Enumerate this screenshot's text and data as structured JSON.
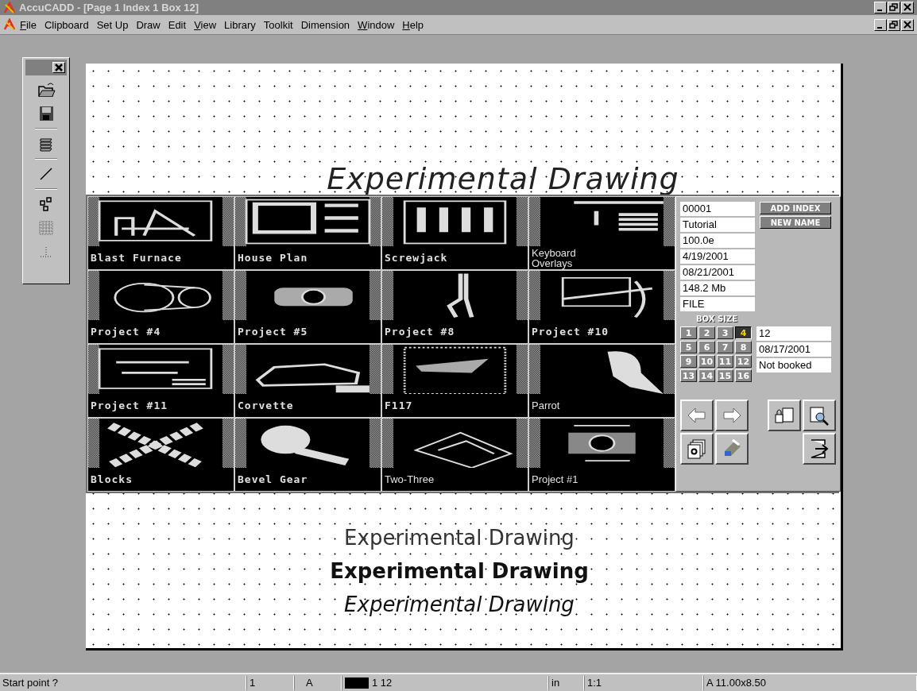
{
  "window": {
    "title": "AccuCADD - [Page 1 Index 1 Box 12]"
  },
  "menu": [
    {
      "label": "File",
      "underline_first": true
    },
    {
      "label": "Clipboard",
      "underline_first": false
    },
    {
      "label": "Set Up",
      "underline_first": false
    },
    {
      "label": "Draw",
      "underline_first": false
    },
    {
      "label": "Edit",
      "underline_first": false
    },
    {
      "label": "View",
      "underline_first": true
    },
    {
      "label": "Library",
      "underline_first": false
    },
    {
      "label": "Toolkit",
      "underline_first": false
    },
    {
      "label": "Dimension",
      "underline_first": false
    },
    {
      "label": "Window",
      "underline_first": true
    },
    {
      "label": "Help",
      "underline_first": true
    }
  ],
  "drawing": {
    "title": "Experimental Drawing",
    "samples": [
      {
        "text": "Experimental Drawing",
        "kind": "light"
      },
      {
        "text": "Experimental Drawing",
        "kind": "bold"
      },
      {
        "text": "Experimental Drawing",
        "kind": "italic"
      }
    ]
  },
  "library": {
    "tiles": [
      {
        "label": "Blast Furnace",
        "kind": "bitmap"
      },
      {
        "label": "House Plan",
        "kind": "bitmap"
      },
      {
        "label": "Screwjack",
        "kind": "bitmap"
      },
      {
        "label": "Keyboard Overlays",
        "kind": "vector"
      },
      {
        "label": "Project #4",
        "kind": "bitmap"
      },
      {
        "label": "Project #5",
        "kind": "bitmap"
      },
      {
        "label": "Project #8",
        "kind": "bitmap"
      },
      {
        "label": "Project #10",
        "kind": "bitmap"
      },
      {
        "label": "Project #11",
        "kind": "bitmap"
      },
      {
        "label": "Corvette",
        "kind": "bitmap"
      },
      {
        "label": "F117",
        "kind": "bitmap"
      },
      {
        "label": "Parrot",
        "kind": "vector"
      },
      {
        "label": "Blocks",
        "kind": "bitmap"
      },
      {
        "label": "Bevel Gear",
        "kind": "bitmap"
      },
      {
        "label": "Two-Three",
        "kind": "vector"
      },
      {
        "label": "Project #1",
        "kind": "vector"
      }
    ],
    "info": [
      "00001",
      "Tutorial",
      "100.0e",
      "4/19/2001",
      "08/21/2001",
      "148.2 Mb",
      "FILE"
    ],
    "buttons": [
      "ADD INDEX",
      "NEW NAME"
    ],
    "box_size_label": "BOX SIZE",
    "box_sizes": [
      {
        "label": "1",
        "selected": false
      },
      {
        "label": "2",
        "selected": false
      },
      {
        "label": "3",
        "selected": false
      },
      {
        "label": "4",
        "selected": true
      },
      {
        "label": "5",
        "selected": false
      },
      {
        "label": "6",
        "selected": false
      },
      {
        "label": "7",
        "selected": false
      },
      {
        "label": "8",
        "selected": false
      },
      {
        "label": "9",
        "selected": false
      },
      {
        "label": "10",
        "selected": false
      },
      {
        "label": "11",
        "selected": false
      },
      {
        "label": "12",
        "selected": false
      },
      {
        "label": "13",
        "selected": false
      },
      {
        "label": "14",
        "selected": false
      },
      {
        "label": "15",
        "selected": false
      },
      {
        "label": "16",
        "selected": false
      }
    ],
    "box_info": [
      "12",
      "08/17/2001",
      "Not booked"
    ]
  },
  "status_bar": {
    "prompt": "Start point ?",
    "layer": "1",
    "text_style": "A",
    "color_pen": "1 12",
    "units": "in",
    "scale": "1:1",
    "sheet": "A 11.00x8.50"
  }
}
